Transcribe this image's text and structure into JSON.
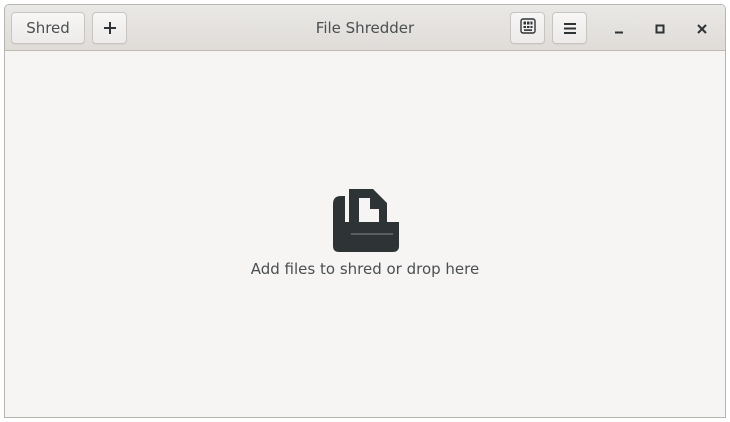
{
  "window": {
    "title": "File Shredder"
  },
  "headerbar": {
    "shred_label": "Shred",
    "add_icon": "plus-icon",
    "keyboard_shortcuts_icon": "keyboard-shortcuts-icon",
    "menu_icon": "hamburger-menu-icon",
    "window_controls": {
      "minimize_icon": "minimize-icon",
      "maximize_icon": "maximize-icon",
      "close_icon": "close-icon"
    }
  },
  "main": {
    "empty_state_icon": "shredder-icon",
    "empty_state_text": "Add files to shred or drop here"
  },
  "colors": {
    "window_bg": "#f6f5f4",
    "headerbar_bg": "#dfdcd8",
    "text": "#4a4f51",
    "icon": "#2e3436"
  }
}
